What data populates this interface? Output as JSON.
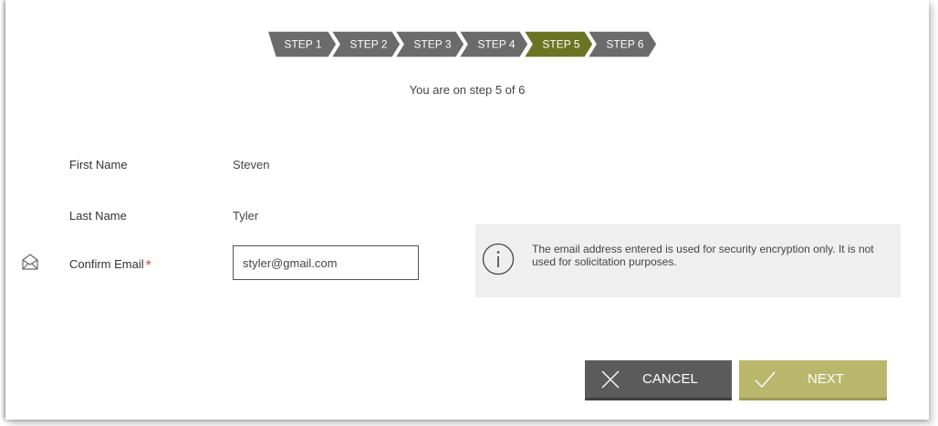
{
  "steps": [
    {
      "label": "STEP 1",
      "active": false
    },
    {
      "label": "STEP 2",
      "active": false
    },
    {
      "label": "STEP 3",
      "active": false
    },
    {
      "label": "STEP 4",
      "active": false
    },
    {
      "label": "STEP 5",
      "active": true
    },
    {
      "label": "STEP 6",
      "active": false
    }
  ],
  "progress_text": "You are on step 5 of 6",
  "fields": {
    "first_name": {
      "label": "First Name",
      "value": "Steven"
    },
    "last_name": {
      "label": "Last Name",
      "value": "Tyler"
    },
    "confirm_email": {
      "label": "Confirm Email",
      "required_mark": "*",
      "value": "styler@gmail.com",
      "icon": "envelope-open-icon"
    }
  },
  "info": {
    "icon": "info-icon",
    "text": "The email address entered is used for security encryption only. It is not used for solicitation purposes."
  },
  "buttons": {
    "cancel": {
      "label": "CANCEL",
      "icon": "x-icon"
    },
    "next": {
      "label": "NEXT",
      "icon": "check-icon"
    }
  },
  "colors": {
    "step_inactive": "#6b6b6b",
    "step_active": "#6b7423",
    "cancel_bg": "#5b5b5b",
    "next_bg": "#b9b76c",
    "info_bg": "#efefef",
    "required": "#c8552d"
  }
}
